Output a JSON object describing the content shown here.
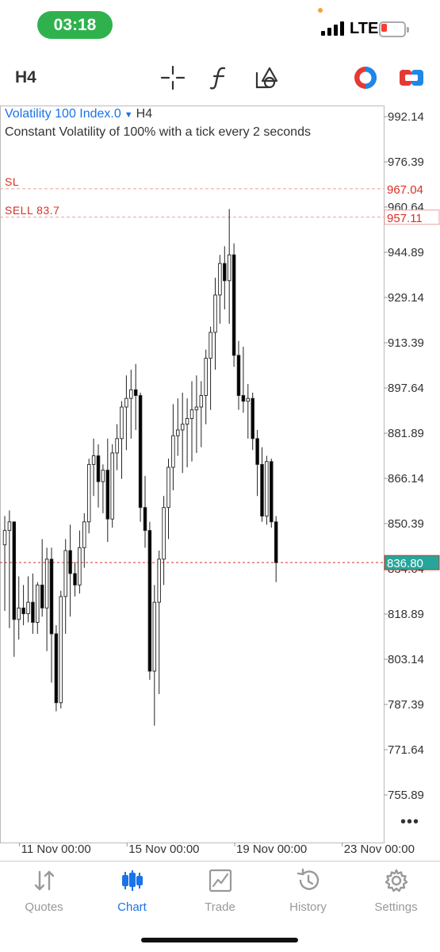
{
  "status_bar": {
    "time": "03:18",
    "network": "LTE"
  },
  "toolbar": {
    "timeframe": "H4"
  },
  "chart_data": {
    "type": "candlestick",
    "symbol": "Volatility 100 Index.0",
    "timeframe": "H4",
    "description": "Constant Volatility of 100% with a tick every 2 seconds",
    "y_axis_ticks": [
      992.14,
      976.39,
      960.64,
      944.89,
      929.14,
      913.39,
      897.64,
      881.89,
      866.14,
      850.39,
      834.64,
      818.89,
      803.14,
      787.39,
      771.64,
      755.89
    ],
    "ylim": [
      744,
      1004
    ],
    "x_tick_labels": [
      "11 Nov 00:00",
      "15 Nov 00:00",
      "19 Nov 00:00",
      "23 Nov 00:00"
    ],
    "x_tick_candle_index": [
      4,
      27,
      50,
      73
    ],
    "current_price": {
      "label": "836.80",
      "value": 836.8,
      "color": "#26a69a"
    },
    "stop_loss": {
      "label": "SL",
      "value": 967.04,
      "value_label": "967.04",
      "color": "#d93025"
    },
    "order": {
      "label": "SELL 83.7",
      "value": 957.11,
      "value_label": "957.11",
      "color": "#d93025"
    },
    "candles": [
      [
        843,
        853,
        820,
        848
      ],
      [
        848,
        855,
        814,
        851
      ],
      [
        851,
        851,
        804,
        817
      ],
      [
        817,
        832,
        810,
        821
      ],
      [
        821,
        829,
        815,
        819
      ],
      [
        819,
        832,
        816,
        823
      ],
      [
        823,
        833,
        812,
        816
      ],
      [
        816,
        830,
        812,
        829
      ],
      [
        829,
        845,
        818,
        821
      ],
      [
        821,
        842,
        806,
        838
      ],
      [
        838,
        842,
        795,
        812
      ],
      [
        812,
        815,
        785,
        788
      ],
      [
        788,
        827,
        786,
        825
      ],
      [
        825,
        845,
        812,
        841
      ],
      [
        841,
        850,
        818,
        833
      ],
      [
        833,
        837,
        825,
        829
      ],
      [
        829,
        848,
        826,
        842
      ],
      [
        842,
        854,
        835,
        851
      ],
      [
        851,
        873,
        847,
        871
      ],
      [
        871,
        880,
        860,
        874
      ],
      [
        874,
        878,
        856,
        865
      ],
      [
        865,
        871,
        854,
        869
      ],
      [
        869,
        880,
        844,
        852
      ],
      [
        852,
        878,
        849,
        875
      ],
      [
        875,
        885,
        869,
        880
      ],
      [
        880,
        893,
        866,
        891
      ],
      [
        891,
        902,
        876,
        894
      ],
      [
        894,
        904,
        880,
        897
      ],
      [
        897,
        906,
        883,
        895
      ],
      [
        895,
        896,
        851,
        856
      ],
      [
        856,
        867,
        842,
        848
      ],
      [
        848,
        851,
        796,
        799
      ],
      [
        799,
        829,
        780,
        823
      ],
      [
        823,
        841,
        791,
        838
      ],
      [
        838,
        860,
        829,
        856
      ],
      [
        856,
        873,
        845,
        870
      ],
      [
        870,
        892,
        862,
        881
      ],
      [
        881,
        894,
        874,
        883
      ],
      [
        883,
        896,
        868,
        885
      ],
      [
        885,
        894,
        870,
        887
      ],
      [
        887,
        900,
        872,
        890
      ],
      [
        890,
        902,
        875,
        891
      ],
      [
        891,
        900,
        877,
        895
      ],
      [
        895,
        911,
        885,
        908
      ],
      [
        908,
        919,
        890,
        917
      ],
      [
        917,
        936,
        904,
        930
      ],
      [
        930,
        944,
        920,
        941
      ],
      [
        941,
        947,
        925,
        935
      ],
      [
        935,
        960,
        920,
        944
      ],
      [
        944,
        948,
        905,
        909
      ],
      [
        909,
        914,
        890,
        895
      ],
      [
        895,
        912,
        889,
        893
      ],
      [
        893,
        899,
        880,
        894
      ],
      [
        894,
        896,
        876,
        880
      ],
      [
        880,
        883,
        860,
        871
      ],
      [
        871,
        877,
        851,
        853
      ],
      [
        853,
        874,
        850,
        872
      ],
      [
        872,
        873,
        849,
        851
      ],
      [
        851,
        853,
        830,
        836.8
      ]
    ]
  },
  "more_label": "•••",
  "tabs": [
    {
      "label": "Quotes",
      "icon": "quotes-icon",
      "active": false
    },
    {
      "label": "Chart",
      "icon": "chart-icon",
      "active": true
    },
    {
      "label": "Trade",
      "icon": "trade-icon",
      "active": false
    },
    {
      "label": "History",
      "icon": "history-icon",
      "active": false
    },
    {
      "label": "Settings",
      "icon": "settings-icon",
      "active": false
    }
  ],
  "colors": {
    "accent": "#1a73e8",
    "level_line": "#d93025",
    "bid_line": "#26a69a",
    "status_pill": "#2fb24e"
  }
}
